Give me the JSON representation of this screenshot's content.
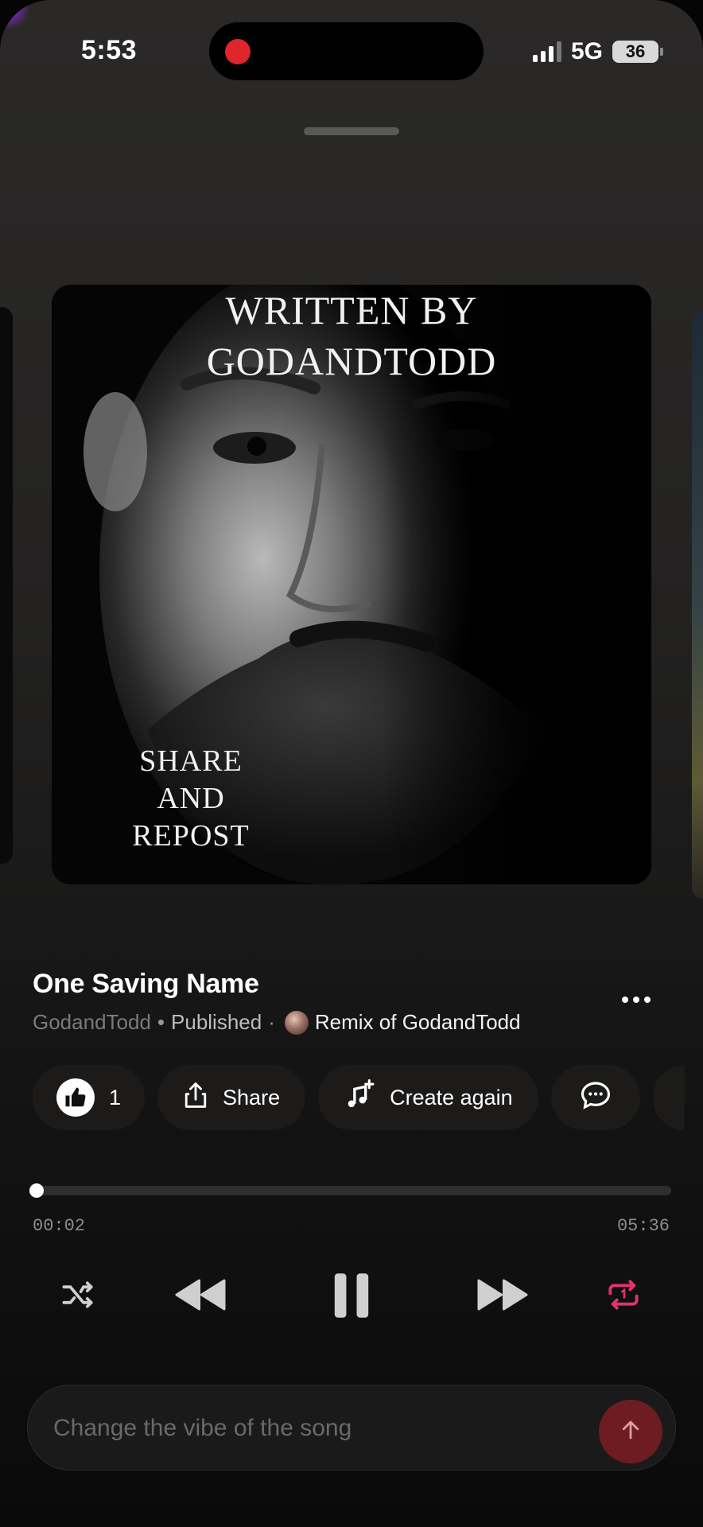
{
  "status_bar": {
    "time": "5:53",
    "network": "5G",
    "battery": "36"
  },
  "cover": {
    "written_by_line1": "WRITTEN BY",
    "written_by_line2": "GODANDTODD",
    "share_line1": "SHARE",
    "share_line2": "AND",
    "share_line3": "REPOST"
  },
  "song": {
    "title": "One Saving Name",
    "artist": "GodandTodd",
    "separator": "•",
    "status": "Published",
    "separator2": "·",
    "remix_label": "Remix of GodandTodd"
  },
  "actions": {
    "like_count": "1",
    "share_label": "Share",
    "create_again_label": "Create again"
  },
  "player": {
    "current_time": "00:02",
    "total_time": "05:36",
    "progress_fraction": 0.006
  },
  "prompt": {
    "placeholder": "Change the vibe of the song"
  },
  "icons": {
    "like": "thumbs-up-icon",
    "share": "share-icon",
    "create": "music-note-sparkle-icon",
    "comment": "comment-icon",
    "shuffle": "shuffle-icon",
    "rewind": "rewind-icon",
    "pause": "pause-icon",
    "forward": "fast-forward-icon",
    "repeat": "repeat-icon",
    "send": "arrow-up-icon"
  },
  "colors": {
    "accent": "#e0346a",
    "recording": "#e0252b",
    "send_button": "#6e1c22"
  }
}
